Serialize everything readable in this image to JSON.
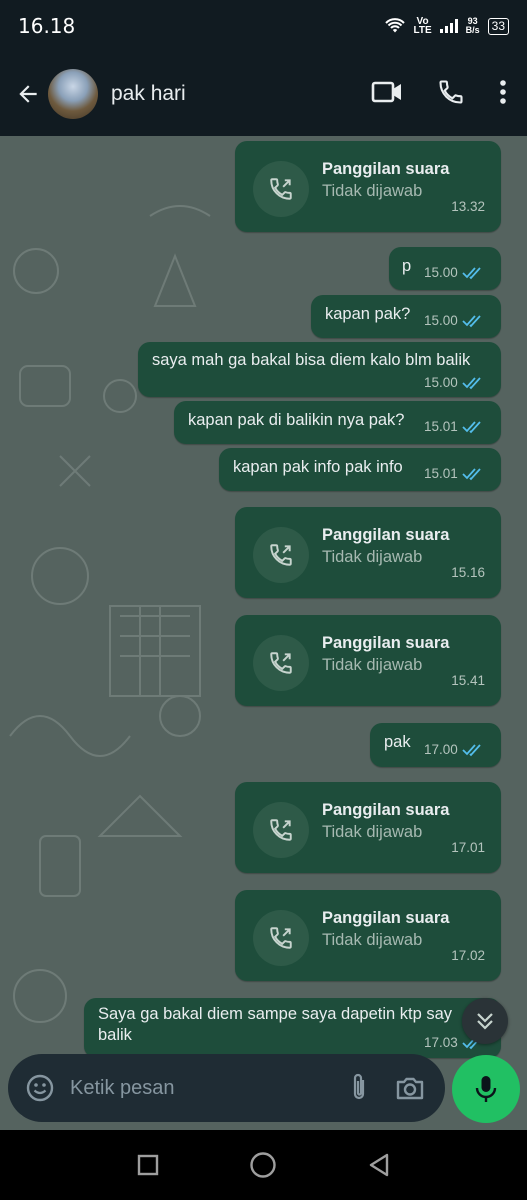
{
  "status_bar": {
    "time": "16.18",
    "network_top": "Vo",
    "network_bottom": "LTE",
    "speed_value": "93",
    "speed_unit": "B/s",
    "battery": "33"
  },
  "header": {
    "contact_name": "pak hari",
    "icons": [
      "back-arrow-icon",
      "video-call-icon",
      "phone-icon",
      "more-vert-icon"
    ]
  },
  "colors": {
    "outgoing_bubble": "#1e4d3b",
    "chat_background": "#55635f",
    "read_tick": "#53bdeb",
    "mic_button": "#21c063"
  },
  "messages": [
    {
      "type": "call",
      "title": "Panggilan suara",
      "status": "Tidak dijawab",
      "time": "13.32"
    },
    {
      "type": "text",
      "text": "p",
      "time": "15.00",
      "read": true
    },
    {
      "type": "text",
      "text": "kapan pak?",
      "time": "15.00",
      "read": true
    },
    {
      "type": "text",
      "text": "saya mah ga bakal bisa diem kalo blm balik",
      "time": "15.00",
      "read": true
    },
    {
      "type": "text",
      "text": "kapan pak di balikin nya pak?",
      "time": "15.01",
      "read": true
    },
    {
      "type": "text",
      "text": "kapan pak info pak info",
      "time": "15.01",
      "read": true
    },
    {
      "type": "call",
      "title": "Panggilan suara",
      "status": "Tidak dijawab",
      "time": "15.16"
    },
    {
      "type": "call",
      "title": "Panggilan suara",
      "status": "Tidak dijawab",
      "time": "15.41"
    },
    {
      "type": "text",
      "text": "pak",
      "time": "17.00",
      "read": true
    },
    {
      "type": "call",
      "title": "Panggilan suara",
      "status": "Tidak dijawab",
      "time": "17.01"
    },
    {
      "type": "call",
      "title": "Panggilan suara",
      "status": "Tidak dijawab",
      "time": "17.02"
    },
    {
      "type": "text",
      "text_line1": "Saya ga bakal diem sampe saya dapetin ktp say",
      "text_line2": "balik",
      "time": "17.03",
      "read": true
    }
  ],
  "composer": {
    "placeholder": "Ketik pesan"
  }
}
